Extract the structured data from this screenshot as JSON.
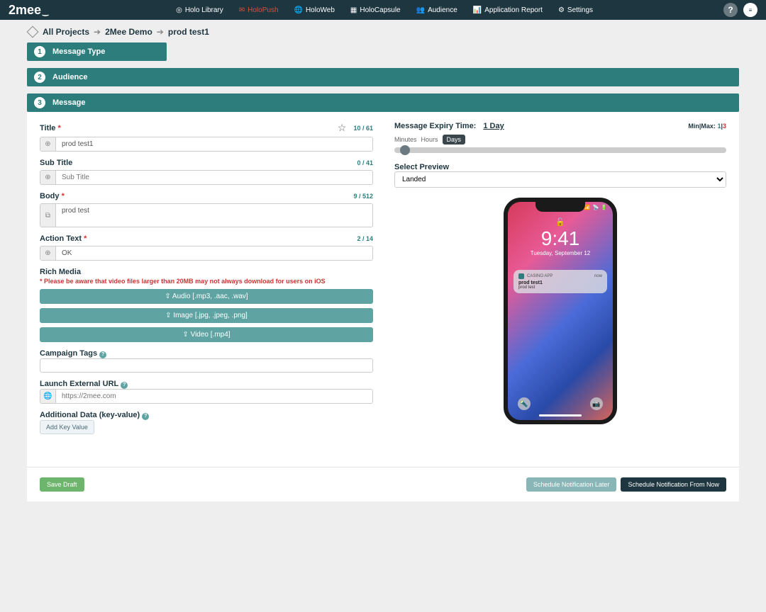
{
  "brand": "2mee",
  "nav": {
    "items": [
      {
        "label": "Holo Library"
      },
      {
        "label": "HoloPush",
        "active": true
      },
      {
        "label": "HoloWeb"
      },
      {
        "label": "HoloCapsule"
      },
      {
        "label": "Audience"
      },
      {
        "label": "Application Report"
      },
      {
        "label": "Settings"
      }
    ]
  },
  "breadcrumb": {
    "root": "All Projects",
    "mid": "2Mee Demo",
    "leaf": "prod test1"
  },
  "steps": {
    "s1": "Message Type",
    "s2": "Audience",
    "s3": "Message"
  },
  "title": {
    "label": "Title",
    "value": "prod test1",
    "counter": "10 / 61"
  },
  "subtitle": {
    "label": "Sub Title",
    "placeholder": "Sub Title",
    "counter": "0 / 41"
  },
  "body": {
    "label": "Body",
    "value": "prod test",
    "counter": "9 / 512"
  },
  "action": {
    "label": "Action Text",
    "value": "OK",
    "counter": "2 / 14"
  },
  "media": {
    "label": "Rich Media",
    "note": "* Please be aware that video files larger than 20MB may not always download for users on iOS",
    "audio": "⇪ Audio [.mp3, .aac, .wav]",
    "image": "⇪ Image [.jpg, .jpeg, .png]",
    "video": "⇪ Video [.mp4]"
  },
  "tags": {
    "label": "Campaign Tags"
  },
  "url": {
    "label": "Launch External URL",
    "placeholder": "https://2mee.com"
  },
  "kv": {
    "label": "Additional Data (key-value)",
    "btn": "Add Key Value"
  },
  "expiry": {
    "label": "Message Expiry Time:",
    "value": "1 Day",
    "minmax_label": "Min|Max:",
    "min": "1",
    "max": "3"
  },
  "units": {
    "minutes": "Minutes",
    "hours": "Hours",
    "days": "Days"
  },
  "preview": {
    "label": "Select Preview",
    "selected": "Landed"
  },
  "phone": {
    "time": "9:41",
    "date": "Tuesday, September 12",
    "app": "CASINO APP",
    "when": "now",
    "ntitle": "prod test1",
    "nbody": "prod test"
  },
  "footer": {
    "draft": "Save Draft",
    "later": "Schedule Notification Later",
    "now": "Schedule Notification From Now"
  }
}
